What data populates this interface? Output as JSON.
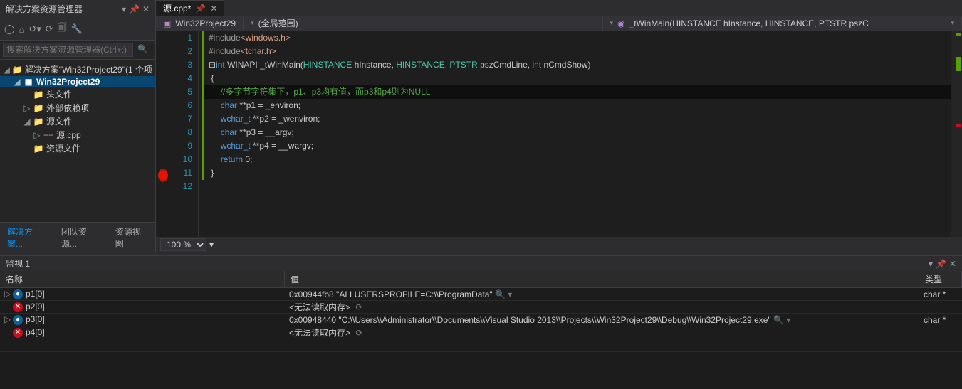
{
  "solution": {
    "panel_title": "解决方案资源管理器",
    "search_placeholder": "搜索解决方案资源管理器(Ctrl+;)",
    "tree": {
      "root": "解决方案\"Win32Project29\"(1 个项",
      "project": "Win32Project29",
      "folders": {
        "headers": "头文件",
        "external": "外部依赖项",
        "source": "源文件",
        "source_file": "源.cpp",
        "resources": "资源文件"
      }
    },
    "bottom_tabs": {
      "a": "解决方案...",
      "b": "团队资源...",
      "c": "资源视图"
    }
  },
  "editor": {
    "tab_name": "源.cpp*",
    "nav_left": "Win32Project29",
    "nav_mid": "(全局范围)",
    "nav_right": "_tWinMain(HINSTANCE hInstance, HINSTANCE, PTSTR pszC",
    "zoom": "100 %"
  },
  "code": {
    "l1_a": "#include",
    "l1_b": "<windows.h>",
    "l2_a": "#include",
    "l2_b": "<tchar.h>",
    "l3_int": "int",
    "l3_api": " WINAPI ",
    "l3_fn": "_tWinMain",
    "l3_op": "(",
    "l3_t1": "HINSTANCE",
    "l3_a1": " hInstance, ",
    "l3_t2": "HINSTANCE",
    "l3_c": ", ",
    "l3_t3": "PTSTR",
    "l3_a3": " pszCmdLine, ",
    "l3_t4": "int",
    "l3_a4": " nCmdShow)",
    "l4": "{",
    "l5": "    //多字节字符集下，p1、p3均有值，而p3和p4则为NULL",
    "l6a": "    ",
    "l6t": "char",
    "l6b": " **p1 = _environ;",
    "l7a": "    ",
    "l7t": "wchar_t",
    "l7b": " **p2 = _wenviron;",
    "l8a": "    ",
    "l8t": "char",
    "l8b": " **p3 = __argv;",
    "l9a": "    ",
    "l9t": "wchar_t",
    "l9b": " **p4 = __wargv;",
    "l10a": "    ",
    "l10t": "return",
    "l10b": " 0;",
    "l11": "}"
  },
  "watch": {
    "title": "监视 1",
    "headers": {
      "name": "名称",
      "value": "值",
      "type": "类型"
    },
    "rows": [
      {
        "ok": true,
        "exp": true,
        "name": "p1[0]",
        "value": "0x00944fb8 \"ALLUSERSPROFILE=C:\\\\ProgramData\"",
        "type": "char *"
      },
      {
        "ok": false,
        "exp": false,
        "name": "p2[0]",
        "value": "<无法读取内存>",
        "type": ""
      },
      {
        "ok": true,
        "exp": true,
        "name": "p3[0]",
        "value": "0x00948440 \"C:\\\\Users\\\\Administrator\\\\Documents\\\\Visual Studio 2013\\\\Projects\\\\Win32Project29\\\\Debug\\\\Win32Project29.exe\"",
        "type": "char *"
      },
      {
        "ok": false,
        "exp": false,
        "name": "p4[0]",
        "value": "<无法读取内存>",
        "type": ""
      }
    ]
  }
}
